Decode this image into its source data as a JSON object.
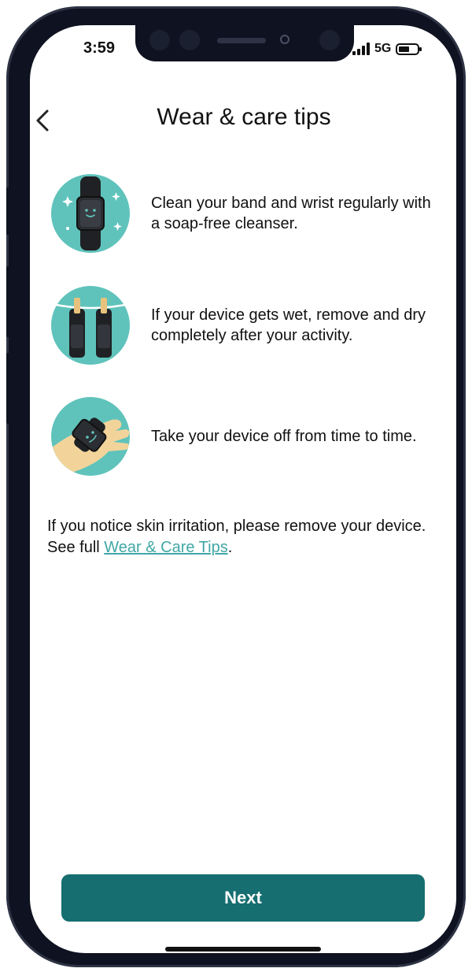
{
  "status_bar": {
    "time": "3:59",
    "network": "5G",
    "battery_level": 0.6
  },
  "header": {
    "back_icon": "chevron-left-icon",
    "title": "Wear & care tips"
  },
  "tips": [
    {
      "icon": "band-clean-icon",
      "text": "Clean your band and wrist regularly with a soap-free cleanser."
    },
    {
      "icon": "bands-drying-icon",
      "text": "If your device gets wet, remove and dry completely after your activity."
    },
    {
      "icon": "hand-device-icon",
      "text": "Take your device off from time to time."
    }
  ],
  "note": {
    "text": "If you notice skin irritation, please remove your device. See full ",
    "link": "Wear & Care Tips",
    "suffix": "."
  },
  "next_button": {
    "label": "Next"
  },
  "colors": {
    "accent": "#166e70",
    "link": "#40a7a5",
    "icon_circle": "#5fc3bb"
  }
}
